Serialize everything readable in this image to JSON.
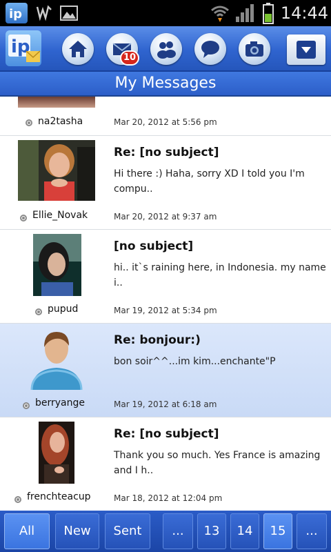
{
  "status_bar": {
    "time": "14:44",
    "icons": [
      "app-notification-icon",
      "signal-wave-icon",
      "image-icon",
      "wifi-icon",
      "cell-signal-icon",
      "battery-icon"
    ]
  },
  "toolbar": {
    "logo_text": "ip",
    "nav": [
      "home-icon",
      "mail-icon",
      "people-icon",
      "chat-bubble-icon",
      "camera-icon"
    ],
    "mail_badge": "10",
    "menu_icon": "dropdown-icon"
  },
  "title": "My Messages",
  "messages": [
    {
      "username": "na2tasha",
      "subject": "",
      "snippet": "",
      "date": "Mar 20, 2012 at 5:56 pm"
    },
    {
      "username": "Ellie_Novak",
      "subject": "Re: [no subject]",
      "snippet": "Hi there :) Haha, sorry XD I told you I'm compu..",
      "date": "Mar 20, 2012 at 9:37 am"
    },
    {
      "username": "pupud",
      "subject": "[no subject]",
      "snippet": "hi.. it`s raining here, in Indonesia. my name i..",
      "date": "Mar 19, 2012 at 5:34 pm"
    },
    {
      "username": "berryange",
      "subject": "Re: bonjour:)",
      "snippet": "bon soir^^...im kim...enchante\"P",
      "date": "Mar 19, 2012 at 6:18 am"
    },
    {
      "username": "frenchteacup",
      "subject": "Re: [no subject]",
      "snippet": "Thank you so much. Yes France is amazing and I h..",
      "date": "Mar 18, 2012 at 12:04 pm"
    }
  ],
  "bottom_tabs": {
    "all": "All",
    "new": "New",
    "sent": "Sent",
    "ellipsis_left": "...",
    "page_13": "13",
    "page_14": "14",
    "page_15": "15",
    "ellipsis_right": "..."
  },
  "colors": {
    "toolbar_blue": "#2f64cf",
    "selected_row": "#c9daf6",
    "badge_red": "#d6261c"
  }
}
